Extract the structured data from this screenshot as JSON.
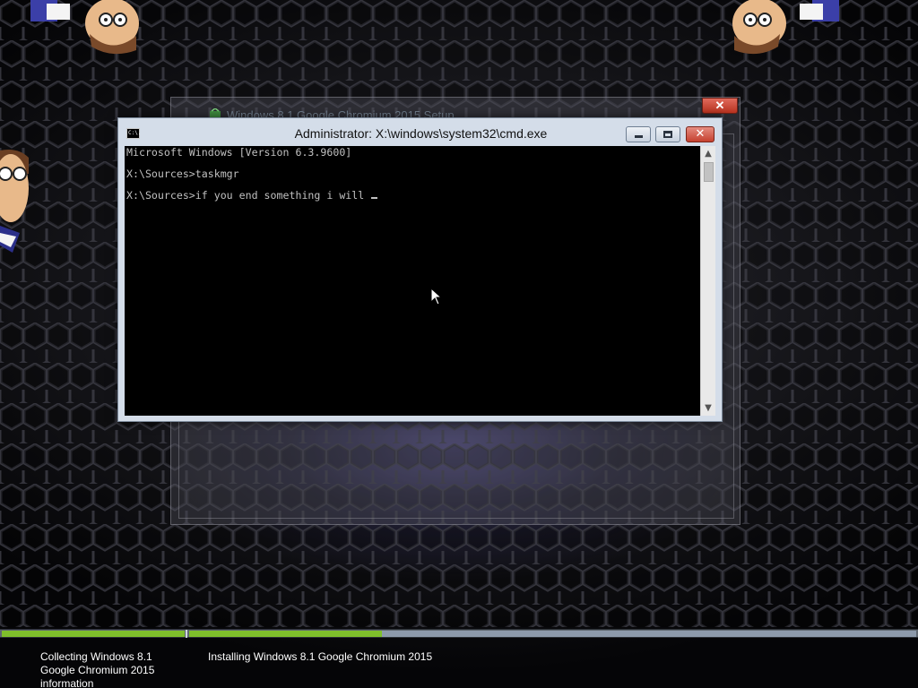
{
  "setup_window": {
    "title": "Windows 8.1 Google Chromium 2015 Setup",
    "close_label": "✕"
  },
  "cmd_window": {
    "title": "Administrator: X:\\windows\\system32\\cmd.exe",
    "icon_text": "C:\\.",
    "lines": [
      "Microsoft Windows [Version 6.3.9600]",
      "",
      "X:\\Sources>taskmgr",
      "",
      "X:\\Sources>if you end something i will "
    ],
    "buttons": {
      "close": "✕"
    },
    "scroll": {
      "up": "▲",
      "down": "▼"
    }
  },
  "progress": {
    "collecting_fraction": 1.0,
    "installing_fraction": 0.265
  },
  "status": {
    "collecting_label": "Collecting Windows 8.1 Google Chromium 2015 information",
    "installing_label": "Installing Windows 8.1 Google Chromium 2015"
  },
  "colors": {
    "progress_green": "#7fbf2b",
    "console_bg": "#000000",
    "console_text": "#c0c0c0"
  }
}
